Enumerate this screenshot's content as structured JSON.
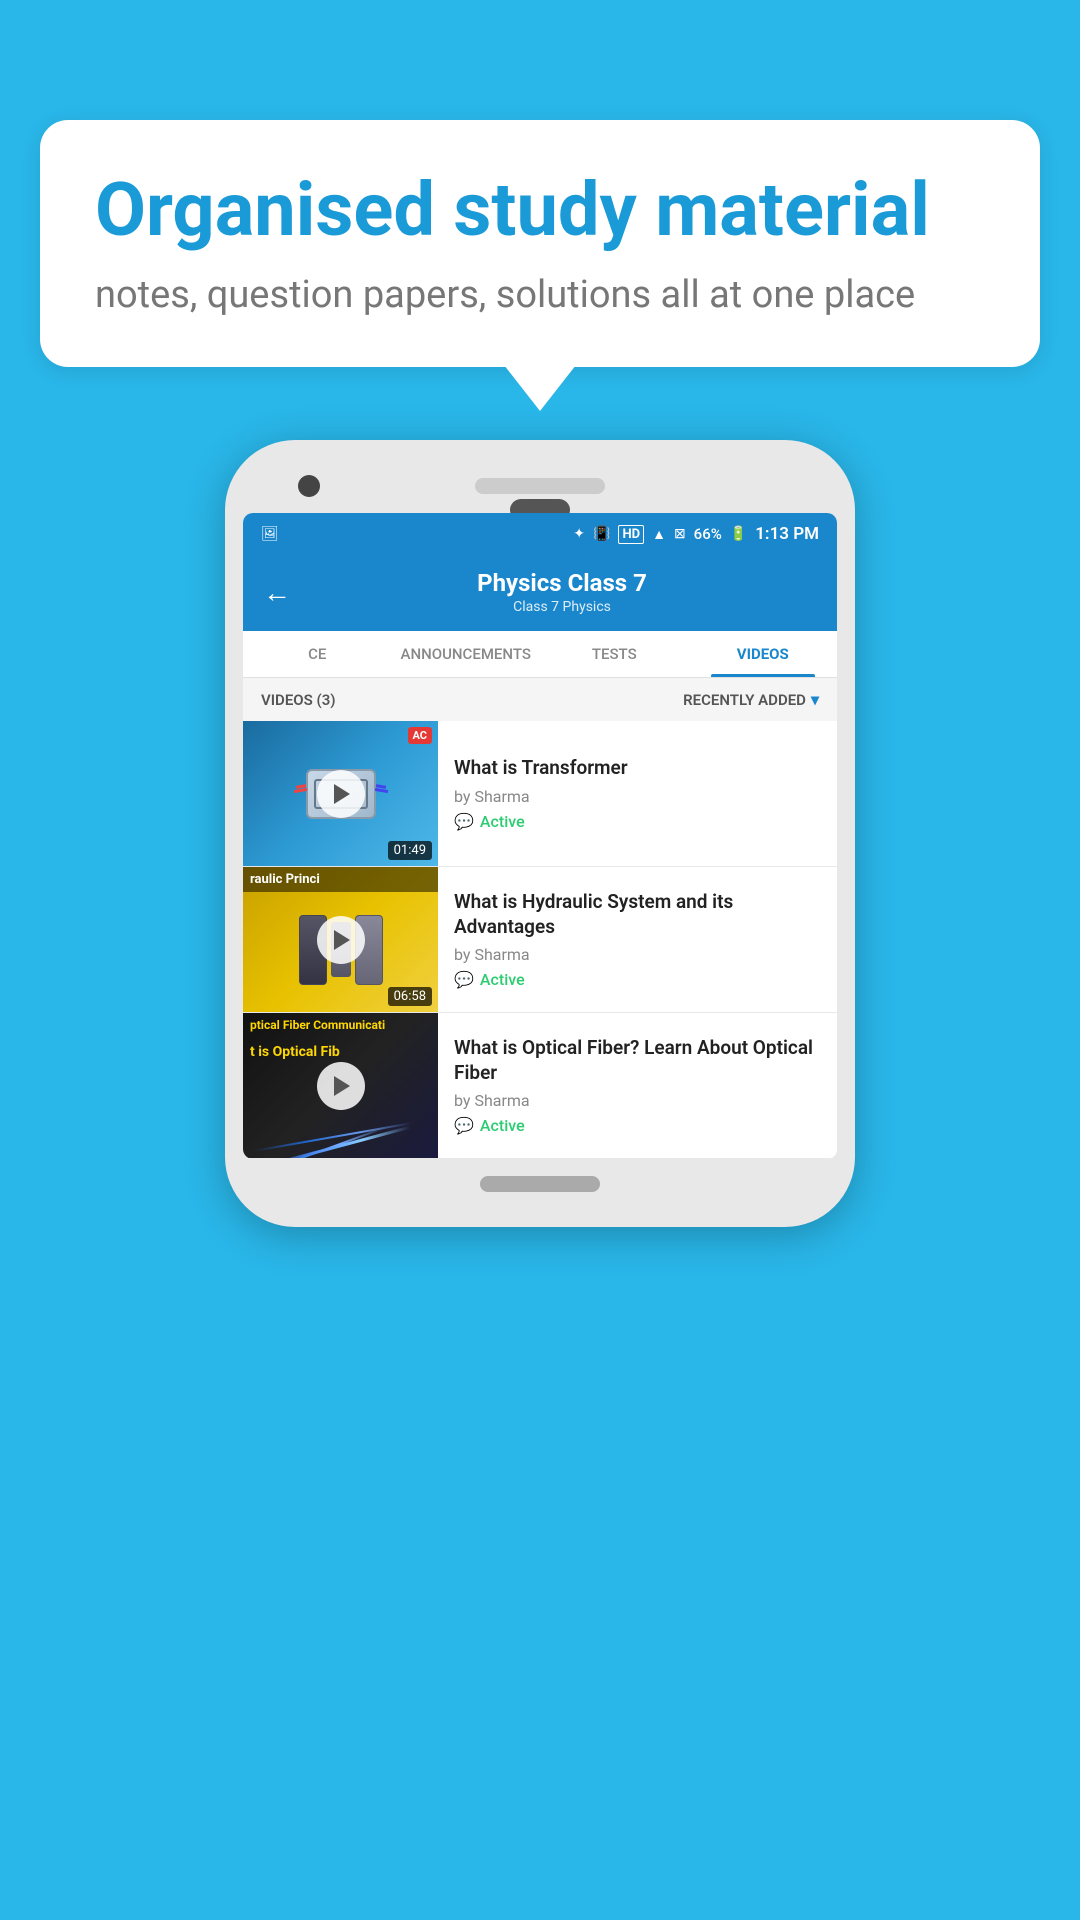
{
  "background_color": "#29b6e8",
  "speech_bubble": {
    "title": "Organised study material",
    "subtitle": "notes, question papers, solutions all at one place"
  },
  "status_bar": {
    "time": "1:13 PM",
    "battery": "66%",
    "signal_icons": "status icons"
  },
  "app_header": {
    "title": "Physics Class 7",
    "breadcrumb": "Class 7   Physics",
    "back_label": "←"
  },
  "tabs": [
    {
      "label": "CE",
      "active": false
    },
    {
      "label": "ANNOUNCEMENTS",
      "active": false
    },
    {
      "label": "TESTS",
      "active": false
    },
    {
      "label": "VIDEOS",
      "active": true
    }
  ],
  "filter_bar": {
    "count_label": "VIDEOS (3)",
    "sort_label": "RECENTLY ADDED",
    "chevron": "▾"
  },
  "videos": [
    {
      "title": "What is  Transformer",
      "author": "by Sharma",
      "status": "Active",
      "duration": "01:49",
      "thumb_type": "transformer",
      "ac_tag": "AC"
    },
    {
      "title": "What is Hydraulic System and its Advantages",
      "author": "by Sharma",
      "status": "Active",
      "duration": "06:58",
      "thumb_type": "hydraulic",
      "thumb_text1": "raulic Princi",
      "ac_tag": ""
    },
    {
      "title": "What is Optical Fiber? Learn About Optical Fiber",
      "author": "by Sharma",
      "status": "Active",
      "duration": "",
      "thumb_type": "optical",
      "thumb_text1": "ptical Fiber Communicati",
      "thumb_text2": "t is Optical Fib",
      "ac_tag": ""
    }
  ]
}
